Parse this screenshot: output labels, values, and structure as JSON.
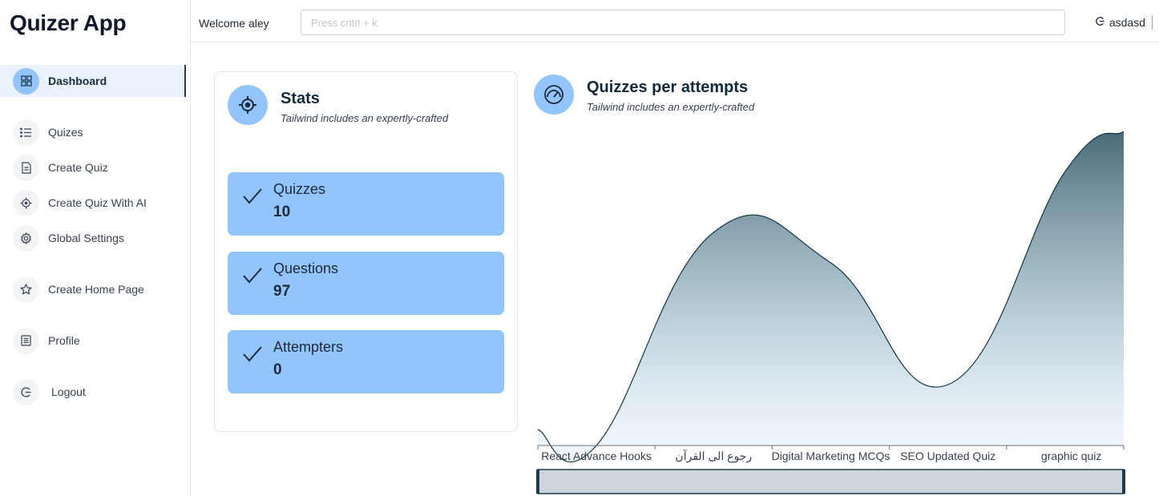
{
  "app": {
    "title": "Quizer App"
  },
  "sidebar": {
    "items": [
      {
        "label": "Dashboard",
        "icon": "dashboard-grid-icon",
        "active": true
      },
      {
        "label": "Quizes",
        "icon": "list-icon"
      },
      {
        "label": "Create Quiz",
        "icon": "document-icon"
      },
      {
        "label": "Create Quiz With AI",
        "icon": "crosshair-icon"
      },
      {
        "label": "Global Settings",
        "icon": "gear-icon"
      },
      {
        "label": "Create Home Page",
        "icon": "star-icon"
      },
      {
        "label": "Profile",
        "icon": "profile-card-icon"
      },
      {
        "label": "Logout",
        "icon": "logout-icon"
      }
    ]
  },
  "header": {
    "welcome": "Welcome aley",
    "search_placeholder": "Press cntrl + k",
    "username": "asdasd"
  },
  "stats": {
    "title": "Stats",
    "subtitle": "Tailwind includes an expertly-crafted",
    "items": [
      {
        "label": "Quizzes",
        "value": "10"
      },
      {
        "label": "Questions",
        "value": "97"
      },
      {
        "label": "Attempters",
        "value": "0"
      }
    ]
  },
  "chart_panel": {
    "title": "Quizzes per attempts",
    "subtitle": "Tailwind includes an expertly-crafted"
  },
  "colors": {
    "accent": "#93c5fd",
    "chart_line": "#0f3442",
    "chart_fill_top": "#4b6b78"
  },
  "chart_data": {
    "type": "area",
    "smooth": true,
    "categories": [
      "React Advance Hooks",
      "رجوع الى القرآن",
      "Digital Marketing MCQs",
      "SEO Updated Quiz",
      "graphic quiz"
    ],
    "series": [
      {
        "values": [
          0,
          7,
          6,
          2,
          9
        ]
      }
    ],
    "ylim": [
      0,
      10
    ],
    "grid": false,
    "data_zoom_slider": true
  }
}
